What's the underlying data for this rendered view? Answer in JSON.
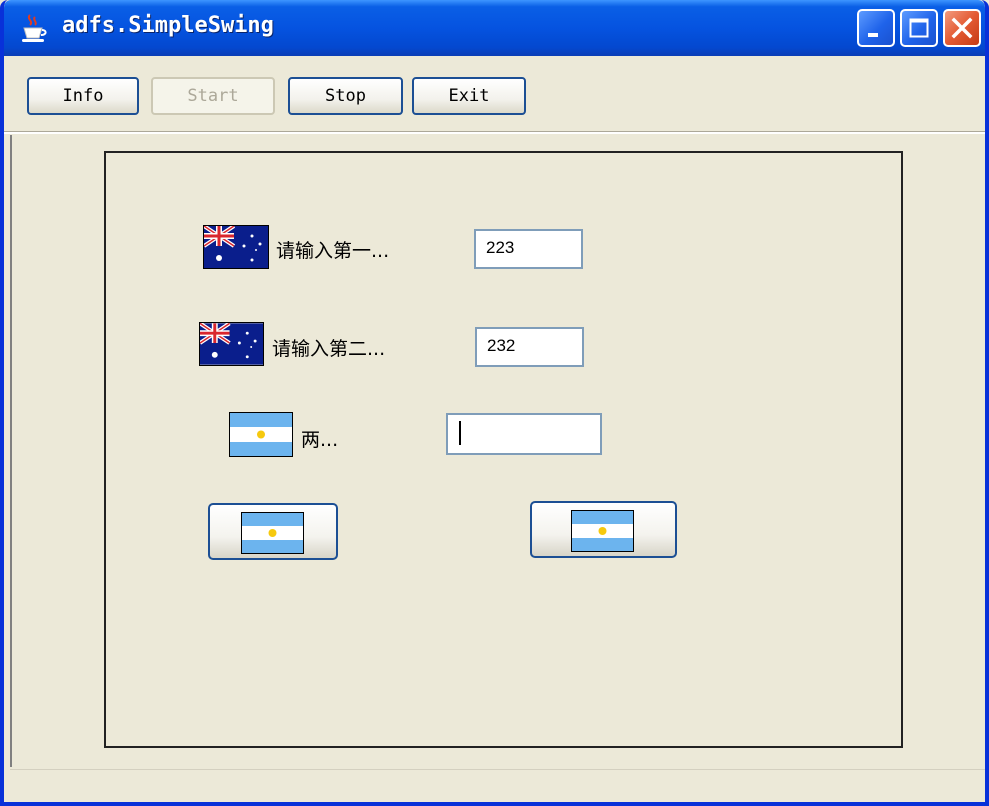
{
  "window": {
    "title": "adfs.SimpleSwing",
    "icon": "java-cup-icon"
  },
  "titlebar_buttons": [
    {
      "name": "minimize",
      "icon": "minimize-icon"
    },
    {
      "name": "maximize",
      "icon": "maximize-icon"
    },
    {
      "name": "close",
      "icon": "close-icon"
    }
  ],
  "toolbar": {
    "info_label": "Info",
    "start_label": "Start",
    "start_enabled": false,
    "stop_label": "Stop",
    "exit_label": "Exit"
  },
  "form": {
    "first": {
      "label": "请输入第一...",
      "value": "223",
      "icon": "australia-flag-icon"
    },
    "second": {
      "label": "请输入第二...",
      "value": "232",
      "icon": "australia-flag-icon"
    },
    "result": {
      "label": "两...",
      "value": "",
      "icon": "argentina-flag-icon"
    },
    "buttons": [
      {
        "icon": "argentina-flag-icon"
      },
      {
        "icon": "argentina-flag-icon"
      }
    ]
  },
  "colors": {
    "titlebar": "#0553e0",
    "face": "#ece9d8",
    "button_border": "#1c4f94",
    "field_border": "#7f9db9"
  }
}
